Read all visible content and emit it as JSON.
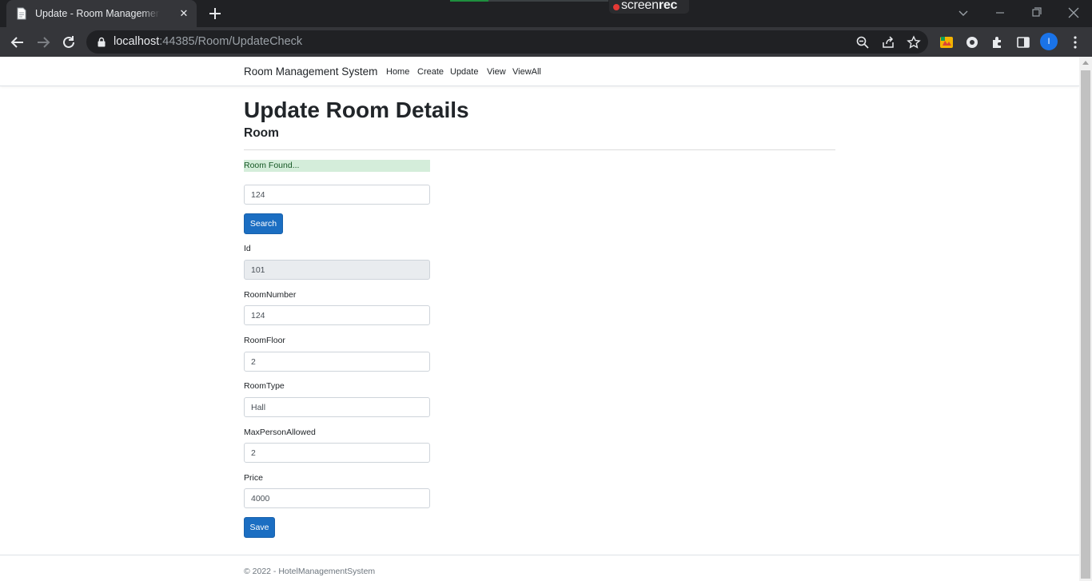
{
  "browser": {
    "tab_title": "Update - Room Management System",
    "url_host": "localhost",
    "url_rest": ":44385/Room/UpdateCheck",
    "recorder_text": "screen",
    "recorder_bold": "rec",
    "profile_initial": "I"
  },
  "site": {
    "brand": "Room Management System",
    "nav": [
      "Home",
      "Create",
      "Update",
      "View",
      "ViewAll"
    ]
  },
  "page": {
    "title": "Update Room Details",
    "subtitle": "Room",
    "status_message": "Room Found...",
    "search_value": "124",
    "search_button": "Search",
    "save_button": "Save"
  },
  "form": {
    "fields": [
      {
        "label": "Id",
        "value": "101",
        "readonly": true
      },
      {
        "label": "RoomNumber",
        "value": "124"
      },
      {
        "label": "RoomFloor",
        "value": "2"
      },
      {
        "label": "RoomType",
        "value": "Hall"
      },
      {
        "label": "MaxPersonAllowed",
        "value": "2"
      },
      {
        "label": "Price",
        "value": "4000"
      }
    ]
  },
  "footer": {
    "text": "© 2022 - HotelManagementSystem"
  },
  "colors": {
    "primary": "#1b6ec2",
    "success_bg": "#d4edda",
    "success_text": "#155724",
    "chrome_dark": "#202124"
  }
}
